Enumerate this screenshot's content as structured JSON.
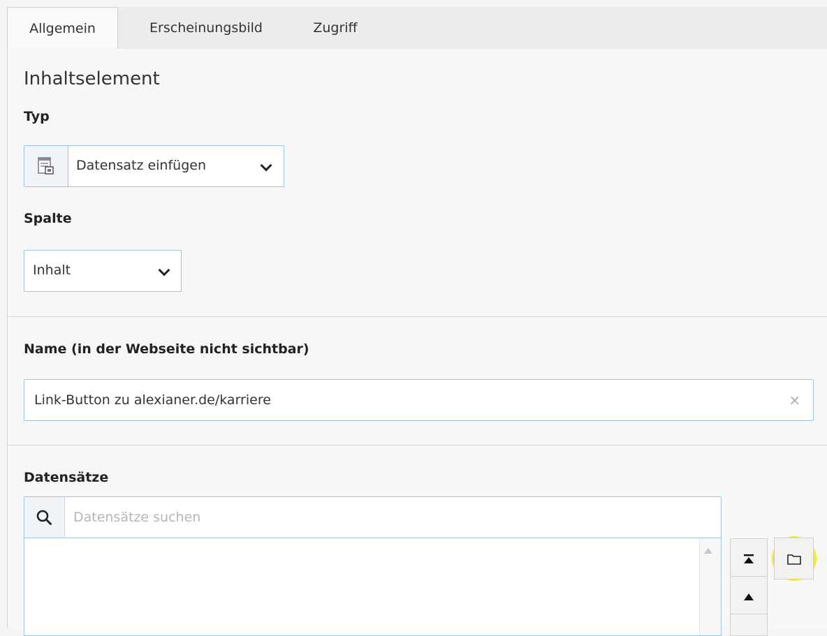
{
  "tabs": [
    {
      "label": "Allgemein",
      "active": true
    },
    {
      "label": "Erscheinungsbild",
      "active": false
    },
    {
      "label": "Zugriff",
      "active": false
    }
  ],
  "section": {
    "title": "Inhaltselement"
  },
  "type_field": {
    "label": "Typ",
    "value": "Datensatz einfügen",
    "icon": "record-insert-icon"
  },
  "column_field": {
    "label": "Spalte",
    "value": "Inhalt"
  },
  "name_field": {
    "label": "Name (in der Webseite nicht sichtbar)",
    "value": "Link-Button zu alexianer.de/karriere",
    "clear_glyph": "×"
  },
  "records_field": {
    "label": "Datensätze",
    "search_placeholder": "Datensätze suchen",
    "move_buttons": [
      "move-to-top-icon",
      "move-up-icon"
    ],
    "browse_button": "folder-icon"
  },
  "colors": {
    "accent_border": "#9cc3e6",
    "highlight": "#f3f200"
  }
}
